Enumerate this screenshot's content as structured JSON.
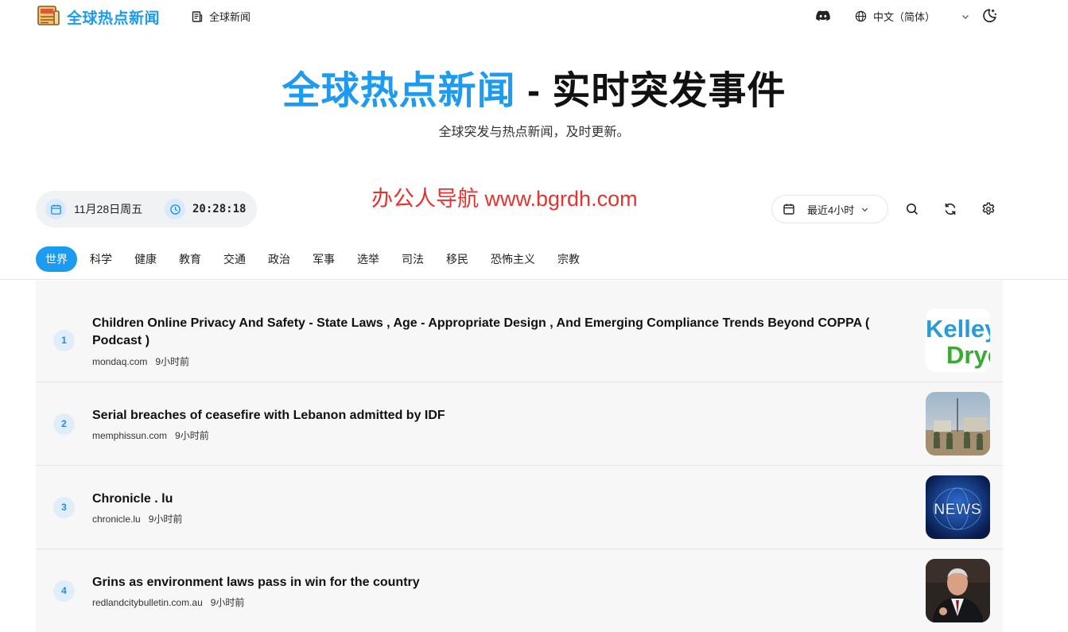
{
  "header": {
    "brand": "全球热点新闻",
    "nav_link": "全球新闻",
    "language": "中文（简体）"
  },
  "hero": {
    "title_accent": "全球热点新闻",
    "title_rest": " - 实时突发事件",
    "subtitle": "全球突发与热点新闻，及时更新。"
  },
  "watermark": "办公人导航 www.bgrdh.com",
  "clock": {
    "date": "11月28日周五",
    "time": "20:28:18"
  },
  "filter": {
    "range_label": "最近4小时"
  },
  "tabs": [
    "世界",
    "科学",
    "健康",
    "教育",
    "交通",
    "政治",
    "军事",
    "选举",
    "司法",
    "移民",
    "恐怖主义",
    "宗教"
  ],
  "active_tab": "世界",
  "colors": {
    "accent": "#1d9bf0",
    "watermark": "#e8322f"
  },
  "news": [
    {
      "index": "1",
      "title": "Children Online Privacy And Safety - State Laws , Age - Appropriate Design , And Emerging Compliance Trends Beyond COPPA ( Podcast )",
      "source": "mondaq.com",
      "ago": "9小时前",
      "thumb_text_1": "Kelley",
      "thumb_text_2": "Drye"
    },
    {
      "index": "2",
      "title": "Serial breaches of ceasefire with Lebanon admitted by IDF",
      "source": "memphissun.com",
      "ago": "9小时前"
    },
    {
      "index": "3",
      "title": "Chronicle . lu",
      "source": "chronicle.lu",
      "ago": "9小时前",
      "thumb_text": "NEWS"
    },
    {
      "index": "4",
      "title": "Grins as environment laws pass in win for the country",
      "source": "redlandcitybulletin.com.au",
      "ago": "9小时前"
    }
  ]
}
